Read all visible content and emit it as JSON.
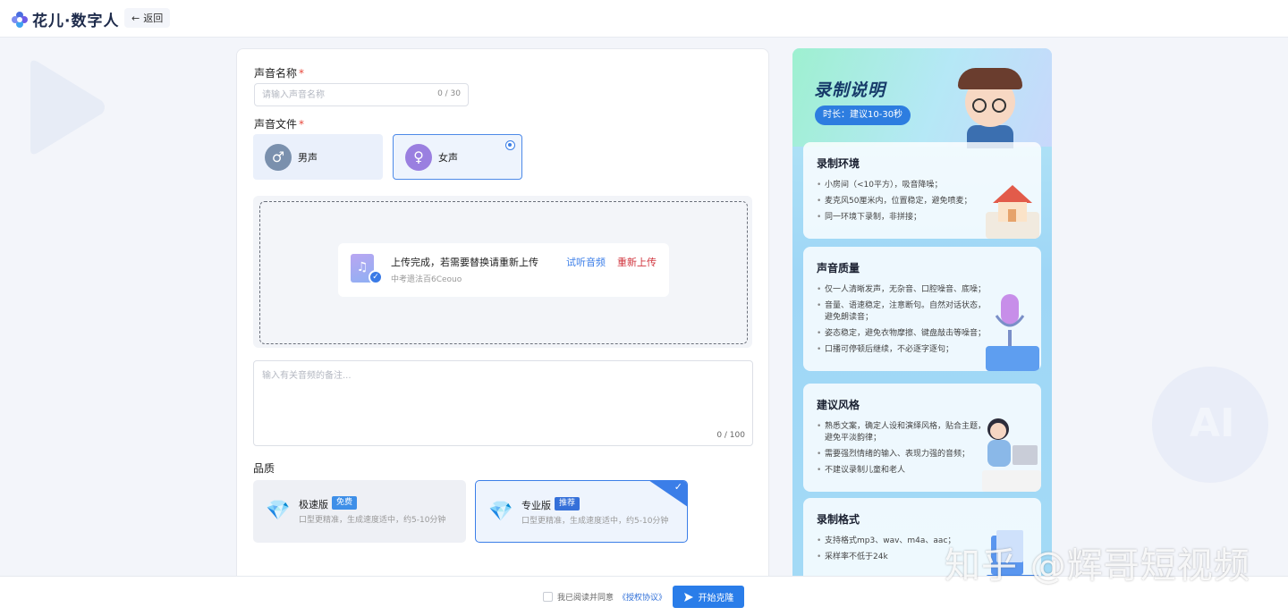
{
  "app": {
    "name": "花儿·数字人",
    "back_label": "返回"
  },
  "form": {
    "voice_name_label": "声音名称",
    "voice_name_placeholder": "请输入声音名称",
    "voice_name_count": "0 / 30",
    "voice_file_label": "声音文件",
    "required_mark": "*",
    "gender_options": [
      {
        "label": "男声",
        "selected": false
      },
      {
        "label": "女声",
        "selected": true
      }
    ],
    "upload": {
      "status": "上传完成，若需要替换请重新上传",
      "file_name": "中考遗法百6Ceouo",
      "listen_label": "试听音频",
      "reupload_label": "重新上传"
    },
    "remark_placeholder": "输入有关音频的备注...",
    "remark_count": "0 / 100",
    "quality_label": "品质",
    "quality_options": [
      {
        "name": "极速版",
        "badge": "免费",
        "desc": "口型更精准，生成速度适中，约5-10分钟",
        "selected": false
      },
      {
        "name": "专业版",
        "badge": "推荐",
        "desc": "口型更精准，生成速度适中，约5-10分钟",
        "selected": true
      }
    ]
  },
  "instructions": {
    "title": "录制说明",
    "duration": "时长：建议10-30秒",
    "sections": [
      {
        "title": "录制环境",
        "items": [
          "小房间（<10平方），吸音降噪；",
          "麦克风50厘米内，位置稳定，避免喷麦；",
          "同一环境下录制，非拼接；"
        ]
      },
      {
        "title": "声音质量",
        "items": [
          "仅一人清晰发声，无杂音、口腔噪音、底噪；",
          "音量、语速稳定，注意断句。自然对话状态，避免朗读音；",
          "姿态稳定，避免衣物摩擦、键盘敲击等噪音；",
          "口播可停顿后继续，不必逐字逐句；"
        ]
      },
      {
        "title": "建议风格",
        "items": [
          "熟悉文案，确定人设和演绎风格，贴合主题，避免平淡韵律；",
          "需要强烈情绪的输入、表现力强的音频；",
          "不建议录制儿童和老人"
        ]
      },
      {
        "title": "录制格式",
        "items": [
          "支持格式mp3、wav、m4a、aac；",
          "采样率不低于24k"
        ]
      }
    ]
  },
  "footer": {
    "agree_text": "我已阅读并同意",
    "agree_link": "《授权协议》",
    "start_label": "开始克隆"
  },
  "watermark": "知乎 @辉哥短视频",
  "colors": {
    "primary": "#2a7de9",
    "danger": "#d0343d",
    "panel": "#a4dbf6"
  }
}
